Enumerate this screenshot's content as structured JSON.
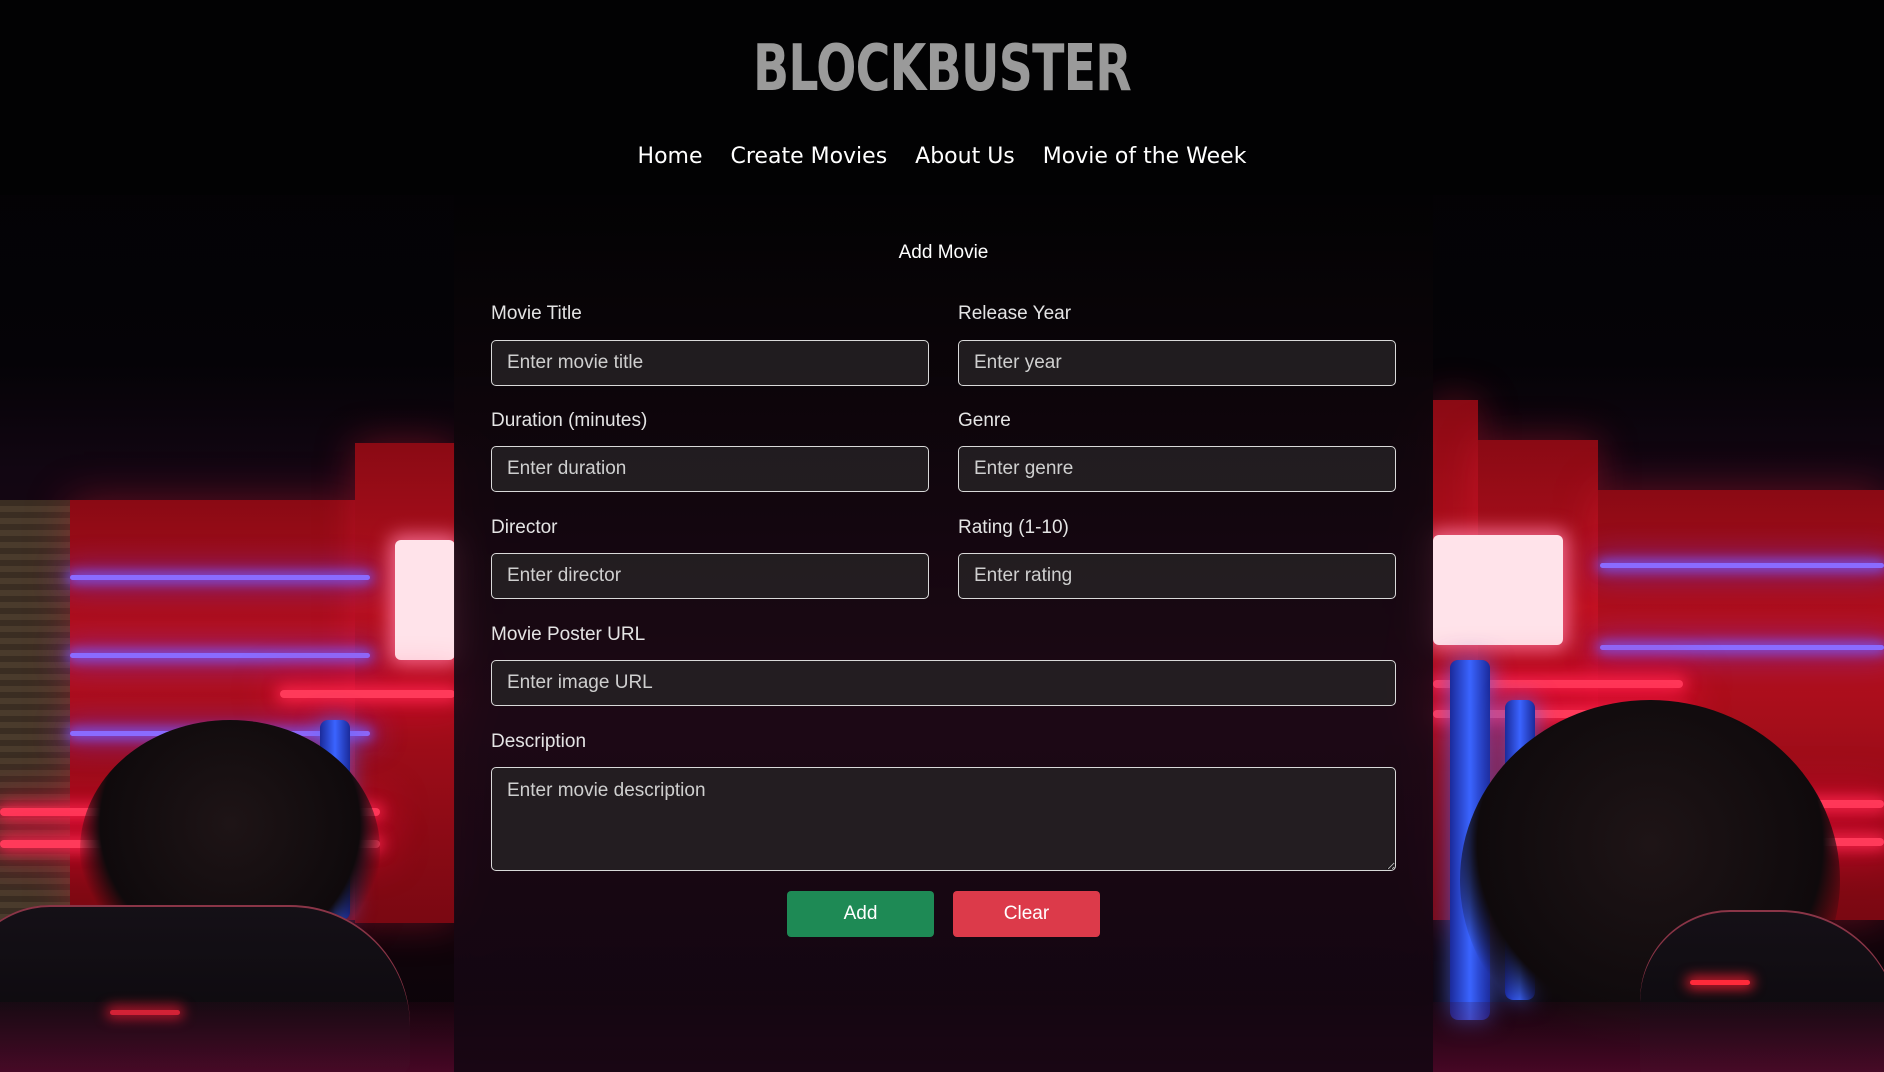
{
  "brand": {
    "title": "BLOCKBUSTER"
  },
  "nav": {
    "items": [
      {
        "label": "Home"
      },
      {
        "label": "Create Movies"
      },
      {
        "label": "About Us"
      },
      {
        "label": "Movie of the Week"
      }
    ]
  },
  "form": {
    "title": "Add Movie",
    "fields": {
      "title": {
        "label": "Movie Title",
        "placeholder": "Enter movie title",
        "value": ""
      },
      "year": {
        "label": "Release Year",
        "placeholder": "Enter year",
        "value": ""
      },
      "duration": {
        "label": "Duration (minutes)",
        "placeholder": "Enter duration",
        "value": ""
      },
      "genre": {
        "label": "Genre",
        "placeholder": "Enter genre",
        "value": ""
      },
      "director": {
        "label": "Director",
        "placeholder": "Enter director",
        "value": ""
      },
      "rating": {
        "label": "Rating (1-10)",
        "placeholder": "Enter rating",
        "value": ""
      },
      "poster": {
        "label": "Movie Poster URL",
        "placeholder": "Enter image URL",
        "value": ""
      },
      "description": {
        "label": "Description",
        "placeholder": "Enter movie description",
        "value": ""
      }
    },
    "buttons": {
      "add": "Add",
      "clear": "Clear"
    }
  },
  "colors": {
    "add_button": "#1e8a55",
    "clear_button": "#dc3a4a",
    "brand_text": "#9a9a9a"
  }
}
